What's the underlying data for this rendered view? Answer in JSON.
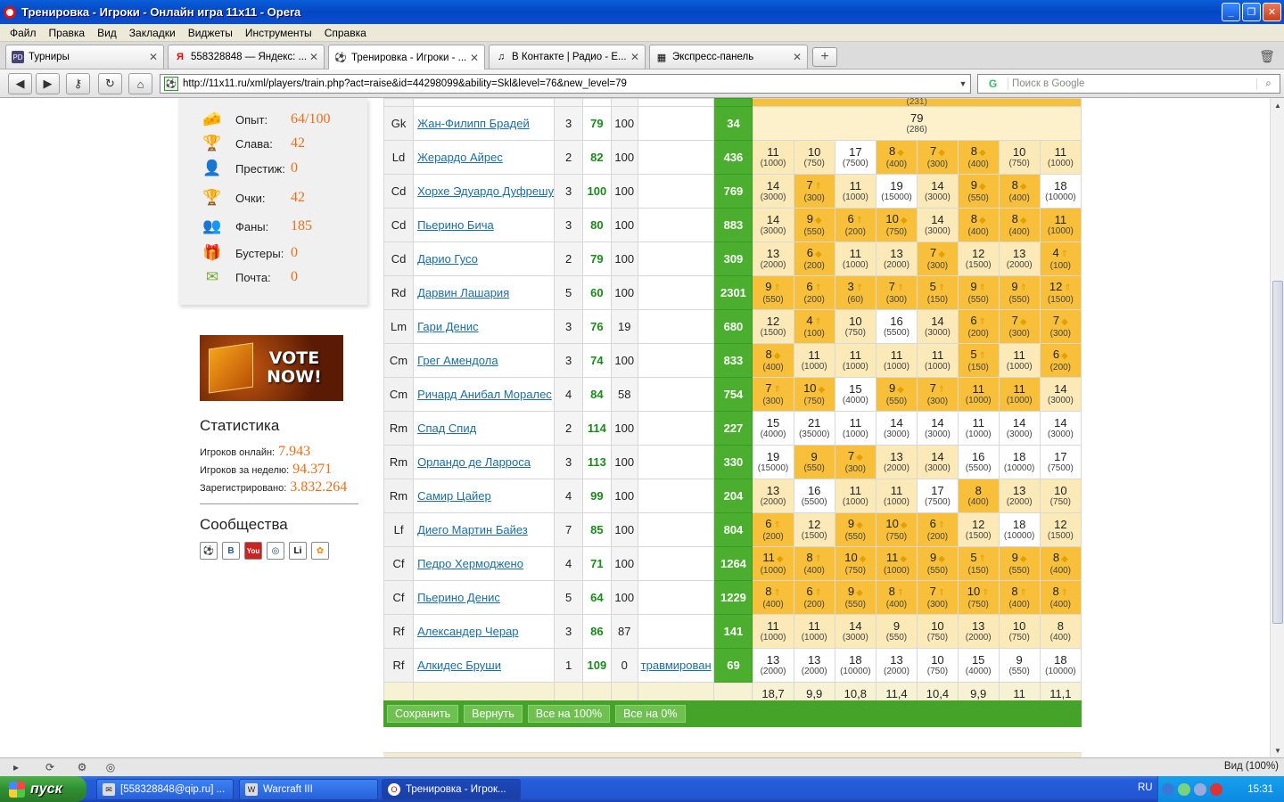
{
  "window": {
    "title": "Тренировка - Игроки - Онлайн игра 11x11 - Opera"
  },
  "menu": [
    "Файл",
    "Правка",
    "Вид",
    "Закладки",
    "Виджеты",
    "Инструменты",
    "Справка"
  ],
  "tabs": [
    {
      "label": "Турниры",
      "icon": "PD"
    },
    {
      "label": "558328848 — Яндекс: ...",
      "icon": "Я"
    },
    {
      "label": "Тренировка - Игроки - ...",
      "icon": "⚽"
    },
    {
      "label": "В Контакте | Радио - Е...",
      "icon": "♫"
    },
    {
      "label": "Экспресс-панель",
      "icon": "▦"
    }
  ],
  "address": {
    "url": "http://11x11.ru/xml/players/train.php?act=raise&id=44298099&ability=Skl&level=76&new_level=79"
  },
  "search": {
    "placeholder": "Поиск в Google",
    "engine": "G"
  },
  "sidebar": {
    "stats": [
      {
        "label": "Опыт:",
        "value": "64/100",
        "icon": "🧀"
      },
      {
        "label": "Слава:",
        "value": "42",
        "icon": "🏆"
      },
      {
        "label": "Престиж:",
        "value": "0",
        "icon": "👤"
      },
      {
        "label": "Очки:",
        "value": "42",
        "icon": "🏆"
      },
      {
        "label": "Фаны:",
        "value": "185",
        "icon": "👥"
      },
      {
        "label": "Бустеры:",
        "value": "0",
        "icon": "🎁"
      },
      {
        "label": "Почта:",
        "value": "0",
        "icon": "✉"
      }
    ],
    "vote": "VOTE NOW!",
    "statistics_title": "Статистика",
    "online": [
      {
        "label": "Игроков онлайн:",
        "value": "7.943"
      },
      {
        "label": "Игроков за неделю:",
        "value": "94.371"
      },
      {
        "label": "Зарегистрировано:",
        "value": "3.832.264"
      }
    ],
    "communities_title": "Сообщества",
    "communities": [
      "⚽",
      "B",
      "You",
      "◎",
      "Li",
      "✿"
    ]
  },
  "goalkeeper": {
    "pos": "Gk",
    "name": "Жан-Филипп Брадей",
    "age": "3",
    "skl": "79",
    "form": "100",
    "status": "",
    "total": "34",
    "value": "79",
    "cost": "(286)"
  },
  "top_partial": "(231)",
  "players": [
    {
      "pos": "Ld",
      "name": "Жерардо Айрес",
      "age": "2",
      "skl": "82",
      "form": "100",
      "status": "",
      "total": "436",
      "cells": [
        [
          "11",
          "(1000)",
          "l",
          ""
        ],
        [
          "10",
          "(750)",
          "l",
          ""
        ],
        [
          "17",
          "(7500)",
          "w",
          ""
        ],
        [
          "8",
          "(400)",
          "o",
          "◆"
        ],
        [
          "7",
          "(300)",
          "o",
          "◆"
        ],
        [
          "8",
          "(400)",
          "o",
          "◆"
        ],
        [
          "10",
          "(750)",
          "l",
          ""
        ],
        [
          "11",
          "(1000)",
          "l",
          ""
        ]
      ]
    },
    {
      "pos": "Cd",
      "name": "Хорхе Эдуардо Дуфрешу",
      "age": "3",
      "skl": "100",
      "form": "100",
      "status": "",
      "total": "769",
      "cells": [
        [
          "14",
          "(3000)",
          "l",
          ""
        ],
        [
          "7",
          "(300)",
          "o",
          "⇑"
        ],
        [
          "11",
          "(1000)",
          "l",
          ""
        ],
        [
          "19",
          "(15000)",
          "w",
          ""
        ],
        [
          "14",
          "(3000)",
          "l",
          ""
        ],
        [
          "9",
          "(550)",
          "o",
          "◆"
        ],
        [
          "8",
          "(400)",
          "o",
          "◆"
        ],
        [
          "18",
          "(10000)",
          "w",
          ""
        ]
      ]
    },
    {
      "pos": "Cd",
      "name": "Пьерино Бича",
      "age": "3",
      "skl": "80",
      "form": "100",
      "status": "",
      "total": "883",
      "cells": [
        [
          "14",
          "(3000)",
          "l",
          ""
        ],
        [
          "9",
          "(550)",
          "o",
          "◆"
        ],
        [
          "6",
          "(200)",
          "o",
          "⇑"
        ],
        [
          "10",
          "(750)",
          "o",
          "◆"
        ],
        [
          "14",
          "(3000)",
          "l",
          ""
        ],
        [
          "8",
          "(400)",
          "o",
          "◆"
        ],
        [
          "8",
          "(400)",
          "o",
          "◆"
        ],
        [
          "11",
          "(1000)",
          "o",
          ""
        ]
      ]
    },
    {
      "pos": "Cd",
      "name": "Дарио Гусо",
      "age": "2",
      "skl": "79",
      "form": "100",
      "status": "",
      "total": "309",
      "cells": [
        [
          "13",
          "(2000)",
          "l",
          ""
        ],
        [
          "6",
          "(200)",
          "o",
          "◆"
        ],
        [
          "11",
          "(1000)",
          "l",
          ""
        ],
        [
          "13",
          "(2000)",
          "l",
          ""
        ],
        [
          "7",
          "(300)",
          "o",
          "◆"
        ],
        [
          "12",
          "(1500)",
          "l",
          ""
        ],
        [
          "13",
          "(2000)",
          "l",
          ""
        ],
        [
          "4",
          "(100)",
          "o",
          "⇑"
        ]
      ]
    },
    {
      "pos": "Rd",
      "name": "Дарвин Лашария",
      "age": "5",
      "skl": "60",
      "form": "100",
      "status": "",
      "total": "2301",
      "cells": [
        [
          "9",
          "(550)",
          "o",
          "⇑"
        ],
        [
          "6",
          "(200)",
          "o",
          "⇑"
        ],
        [
          "3",
          "(60)",
          "o",
          "⇑"
        ],
        [
          "7",
          "(300)",
          "o",
          "⇑"
        ],
        [
          "5",
          "(150)",
          "o",
          "⇑"
        ],
        [
          "9",
          "(550)",
          "o",
          "⇑"
        ],
        [
          "9",
          "(550)",
          "o",
          "⇑"
        ],
        [
          "12",
          "(1500)",
          "o",
          "⇑"
        ]
      ]
    },
    {
      "pos": "Lm",
      "name": "Гари Денис",
      "age": "3",
      "skl": "76",
      "form": "19",
      "status": "",
      "total": "680",
      "cells": [
        [
          "12",
          "(1500)",
          "l",
          ""
        ],
        [
          "4",
          "(100)",
          "o",
          "⇑"
        ],
        [
          "10",
          "(750)",
          "l",
          ""
        ],
        [
          "16",
          "(5500)",
          "w",
          ""
        ],
        [
          "14",
          "(3000)",
          "l",
          ""
        ],
        [
          "6",
          "(200)",
          "o",
          "⇑"
        ],
        [
          "7",
          "(300)",
          "o",
          "◆"
        ],
        [
          "7",
          "(300)",
          "o",
          "◆"
        ]
      ]
    },
    {
      "pos": "Cm",
      "name": "Грег Амендола",
      "age": "3",
      "skl": "74",
      "form": "100",
      "status": "",
      "total": "833",
      "cells": [
        [
          "8",
          "(400)",
          "o",
          "◆"
        ],
        [
          "11",
          "(1000)",
          "l",
          ""
        ],
        [
          "11",
          "(1000)",
          "l",
          ""
        ],
        [
          "11",
          "(1000)",
          "l",
          ""
        ],
        [
          "11",
          "(1000)",
          "l",
          ""
        ],
        [
          "5",
          "(150)",
          "o",
          "⇑"
        ],
        [
          "11",
          "(1000)",
          "l",
          ""
        ],
        [
          "6",
          "(200)",
          "o",
          "◆"
        ]
      ]
    },
    {
      "pos": "Cm",
      "name": "Ричард Анибал Моралес",
      "age": "4",
      "skl": "84",
      "form": "58",
      "status": "",
      "total": "754",
      "cells": [
        [
          "7",
          "(300)",
          "o",
          "⇑"
        ],
        [
          "10",
          "(750)",
          "o",
          "◆"
        ],
        [
          "15",
          "(4000)",
          "w",
          ""
        ],
        [
          "9",
          "(550)",
          "o",
          "◆"
        ],
        [
          "7",
          "(300)",
          "o",
          "⇑"
        ],
        [
          "11",
          "(1000)",
          "o",
          ""
        ],
        [
          "11",
          "(1000)",
          "o",
          ""
        ],
        [
          "14",
          "(3000)",
          "l",
          ""
        ]
      ]
    },
    {
      "pos": "Rm",
      "name": "Спад Спид",
      "age": "2",
      "skl": "114",
      "form": "100",
      "status": "",
      "total": "227",
      "cells": [
        [
          "15",
          "(4000)",
          "w",
          ""
        ],
        [
          "21",
          "(35000)",
          "w",
          ""
        ],
        [
          "11",
          "(1000)",
          "w",
          ""
        ],
        [
          "14",
          "(3000)",
          "w",
          ""
        ],
        [
          "14",
          "(3000)",
          "w",
          ""
        ],
        [
          "11",
          "(1000)",
          "w",
          ""
        ],
        [
          "14",
          "(3000)",
          "w",
          ""
        ],
        [
          "14",
          "(3000)",
          "w",
          ""
        ]
      ]
    },
    {
      "pos": "Rm",
      "name": "Орландо де Ларроса",
      "age": "3",
      "skl": "113",
      "form": "100",
      "status": "",
      "total": "330",
      "cells": [
        [
          "19",
          "(15000)",
          "w",
          ""
        ],
        [
          "9",
          "(550)",
          "o",
          ""
        ],
        [
          "7",
          "(300)",
          "o",
          "◆"
        ],
        [
          "13",
          "(2000)",
          "l",
          ""
        ],
        [
          "14",
          "(3000)",
          "l",
          ""
        ],
        [
          "16",
          "(5500)",
          "w",
          ""
        ],
        [
          "18",
          "(10000)",
          "w",
          ""
        ],
        [
          "17",
          "(7500)",
          "w",
          ""
        ]
      ]
    },
    {
      "pos": "Rm",
      "name": "Самир Цайер",
      "age": "4",
      "skl": "99",
      "form": "100",
      "status": "",
      "total": "204",
      "cells": [
        [
          "13",
          "(2000)",
          "l",
          ""
        ],
        [
          "16",
          "(5500)",
          "w",
          ""
        ],
        [
          "11",
          "(1000)",
          "l",
          ""
        ],
        [
          "11",
          "(1000)",
          "l",
          ""
        ],
        [
          "17",
          "(7500)",
          "w",
          ""
        ],
        [
          "8",
          "(400)",
          "o",
          ""
        ],
        [
          "13",
          "(2000)",
          "l",
          ""
        ],
        [
          "10",
          "(750)",
          "l",
          ""
        ]
      ]
    },
    {
      "pos": "Lf",
      "name": "Диего Мартин Байез",
      "age": "7",
      "skl": "85",
      "form": "100",
      "status": "",
      "total": "804",
      "cells": [
        [
          "6",
          "(200)",
          "o",
          "⇑"
        ],
        [
          "12",
          "(1500)",
          "l",
          ""
        ],
        [
          "9",
          "(550)",
          "o",
          "◆"
        ],
        [
          "10",
          "(750)",
          "o",
          "◆"
        ],
        [
          "6",
          "(200)",
          "o",
          "⇑"
        ],
        [
          "12",
          "(1500)",
          "l",
          ""
        ],
        [
          "18",
          "(10000)",
          "w",
          ""
        ],
        [
          "12",
          "(1500)",
          "l",
          ""
        ]
      ]
    },
    {
      "pos": "Cf",
      "name": "Педро Хермодженo",
      "age": "4",
      "skl": "71",
      "form": "100",
      "status": "",
      "total": "1264",
      "cells": [
        [
          "11",
          "(1000)",
          "o",
          "◆"
        ],
        [
          "8",
          "(400)",
          "o",
          "⇑"
        ],
        [
          "10",
          "(750)",
          "o",
          "◆"
        ],
        [
          "11",
          "(1000)",
          "o",
          "◆"
        ],
        [
          "9",
          "(550)",
          "o",
          "◆"
        ],
        [
          "5",
          "(150)",
          "o",
          "⇑"
        ],
        [
          "9",
          "(550)",
          "o",
          "◆"
        ],
        [
          "8",
          "(400)",
          "o",
          "◆"
        ]
      ]
    },
    {
      "pos": "Cf",
      "name": "Пьерино Денис",
      "age": "5",
      "skl": "64",
      "form": "100",
      "status": "",
      "total": "1229",
      "cells": [
        [
          "8",
          "(400)",
          "o",
          "⇑"
        ],
        [
          "6",
          "(200)",
          "o",
          "⇑"
        ],
        [
          "9",
          "(550)",
          "o",
          "◆"
        ],
        [
          "8",
          "(400)",
          "o",
          "⇑"
        ],
        [
          "7",
          "(300)",
          "o",
          "⇑"
        ],
        [
          "10",
          "(750)",
          "o",
          "⇑"
        ],
        [
          "8",
          "(400)",
          "o",
          "⇑"
        ],
        [
          "8",
          "(400)",
          "o",
          "⇑"
        ]
      ]
    },
    {
      "pos": "Rf",
      "name": "Александер Черар",
      "age": "3",
      "skl": "86",
      "form": "87",
      "status": "",
      "total": "141",
      "cells": [
        [
          "11",
          "(1000)",
          "l",
          ""
        ],
        [
          "11",
          "(1000)",
          "l",
          ""
        ],
        [
          "14",
          "(3000)",
          "l",
          ""
        ],
        [
          "9",
          "(550)",
          "l",
          ""
        ],
        [
          "10",
          "(750)",
          "l",
          ""
        ],
        [
          "13",
          "(2000)",
          "l",
          ""
        ],
        [
          "10",
          "(750)",
          "l",
          ""
        ],
        [
          "8",
          "(400)",
          "l",
          ""
        ]
      ]
    },
    {
      "pos": "Rf",
      "name": "Алкидес Бруши",
      "age": "1",
      "skl": "109",
      "form": "0",
      "status": "травмирован",
      "total": "69",
      "cells": [
        [
          "13",
          "(2000)",
          "w",
          ""
        ],
        [
          "13",
          "(2000)",
          "w",
          ""
        ],
        [
          "18",
          "(10000)",
          "w",
          ""
        ],
        [
          "13",
          "(2000)",
          "w",
          ""
        ],
        [
          "10",
          "(750)",
          "w",
          ""
        ],
        [
          "15",
          "(4000)",
          "w",
          ""
        ],
        [
          "9",
          "(550)",
          "w",
          ""
        ],
        [
          "18",
          "(10000)",
          "w",
          ""
        ]
      ]
    }
  ],
  "averages": [
    "18,7",
    "9,9",
    "10,8",
    "11,4",
    "10,4",
    "9,9",
    "11",
    "11,1"
  ],
  "actions": [
    "Сохранить",
    "Вернуть",
    "Все на 100%",
    "Все на 0%"
  ],
  "statusbar": {
    "zoom": "Вид (100%)"
  },
  "taskbar": {
    "start": "пуск",
    "items": [
      "[558328848@qip.ru] ...",
      "Warcraft III",
      "Тренировка - Игрок..."
    ],
    "lang": "RU",
    "clock": "15:31"
  }
}
